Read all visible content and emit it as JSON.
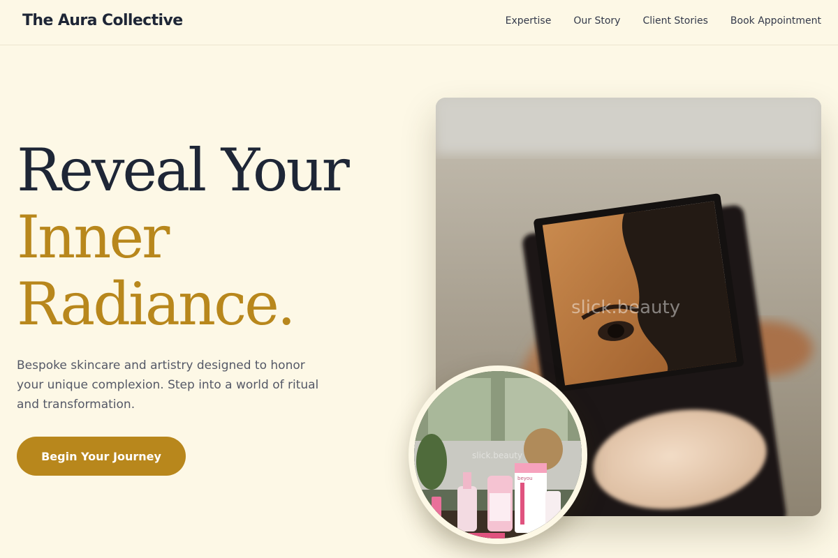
{
  "header": {
    "brand": "The Aura Collective",
    "nav": [
      "Expertise",
      "Our Story",
      "Client Stories",
      "Book Appointment"
    ]
  },
  "hero": {
    "headline_line1": "Reveal Your",
    "headline_line2": "Inner",
    "headline_line3": "Radiance.",
    "subtext": "Bespoke skincare and artistry designed to honor your unique complexion. Step into a world of ritual and transformation.",
    "cta_label": "Begin Your Journey"
  },
  "images": {
    "main_watermark": "slick.beauty",
    "circle_watermark": "slick.beauty",
    "product_brand": "beyou"
  },
  "colors": {
    "background": "#fdf8e6",
    "accent": "#b8871c",
    "text_dark": "#1e2636",
    "text_muted": "#545866"
  }
}
